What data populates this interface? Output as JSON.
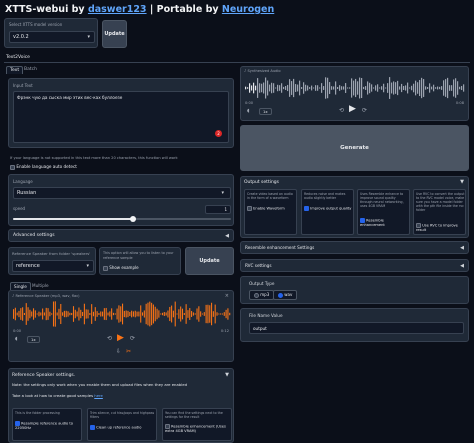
{
  "header": {
    "title": "XTTS-webui",
    "by1": " by ",
    "author": "daswer123",
    "sep": " | Portable by ",
    "author2": "Neurogen"
  },
  "model_version": {
    "label": "Select XTTS model version",
    "value": "v2.0.2"
  },
  "update_button": "Update",
  "main_tab": "Text2Voice",
  "subtabs": [
    "Text",
    "Batch"
  ],
  "input_text": {
    "label": "Input Text",
    "value": "Фрэнк чую да сыска мир этих вес-ках буллоезе",
    "counter": "2"
  },
  "warning_text": "If your language is not supported in this text more than 20 characters, this function will work",
  "autodetect_label": "Enable language auto detect",
  "language": {
    "label": "Language",
    "value": "Russian"
  },
  "speed": {
    "label": "speed",
    "value": "1",
    "fraction": 0.55
  },
  "advanced_settings": "Advanced settings",
  "reference_speaker": {
    "label": "Reference Speaker from folder 'speakers'",
    "value": "reference",
    "info": "This option will allow you to listen to your reference sample",
    "show_example": "Show example",
    "update": "Update"
  },
  "ref_tabs": [
    "Single",
    "Multiple"
  ],
  "ref_audio": {
    "label": "Reference Speaker (mp3, wav, flac)",
    "time_start": "0:00",
    "time_end": "0:12",
    "speed": "1x"
  },
  "ref_settings": {
    "title": "Reference Speaker settings.",
    "note": "Note: the settings only work when you enable them and upload files when they are enabled",
    "guide_prefix": "Take a look at how to create good samples ",
    "guide_link": "here",
    "col1_info": "This is the folder processing",
    "col1_option": "Resample reference audio to 22050Hz",
    "col2_info": "Trim silence, cut hiss/pops and highpass filters",
    "col2_option": "Clean up reference audio",
    "col3_info": "You can find the settings next to the settings for the result",
    "col3_option": "Resemble enhancement (Uses extra 4GB VRAM)"
  },
  "synth_audio": {
    "label": "Synthesized Audio",
    "time_start": "0:00",
    "time_end": "0:08",
    "speed": "1x"
  },
  "generate_button": "Generate",
  "output_settings": {
    "title": "Output settings",
    "col1_info": "Create video based on audio in the form of a waveform",
    "col1_option": "Enable Waveform",
    "col2_info": "Reduces noise and makes audio slightly better",
    "col2_option": "Improve output quality",
    "col3_info": "Uses Resemble enhance to improve sound quality through neural networking, uses 4GB VRAM",
    "col3_option": "Resemble enhancement",
    "col4_info": "Use RVC to convert the output to the RVC model voice, make sure you have a model folder with the pth file inside the rvc folder",
    "col4_option": "Use RVC to improve result"
  },
  "resemble_settings": "Resemble enhancement Settings",
  "rvc_settings": "RVC settings",
  "output_type": {
    "label": "Output Type",
    "options": [
      "mp3",
      "wav"
    ],
    "selected": "wav"
  },
  "file_name": {
    "label": "File Name Value",
    "value": "output"
  },
  "colors": {
    "accent": "#f97316",
    "link": "#60a5fa",
    "check": "#2563eb",
    "counter": "#dc2626"
  }
}
